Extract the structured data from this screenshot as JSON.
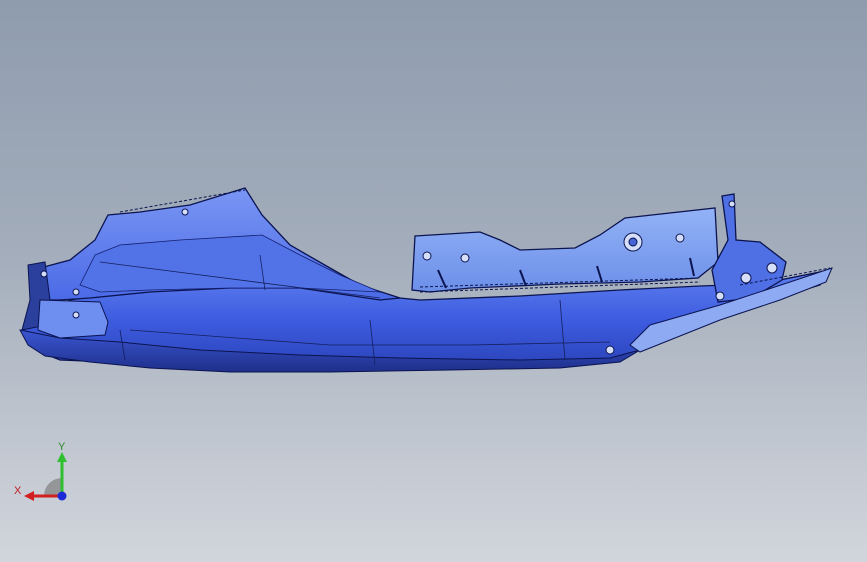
{
  "window": {
    "title": ""
  },
  "viewport": {
    "background_top": "#8f9cae",
    "background_bottom": "#d1d5dc",
    "model": {
      "name": "bumper-bracket-part",
      "body_color": "#3f5ee0",
      "edge_color": "#0b1450",
      "bracket_color": "#7ea2f2"
    }
  },
  "triad": {
    "y_label": "Y",
    "x_label": "X",
    "y_color": "#2fbf2f",
    "x_color": "#d21f1f",
    "z_color": "#1c2ad8",
    "plane_icon": "reference-plane-icon"
  }
}
